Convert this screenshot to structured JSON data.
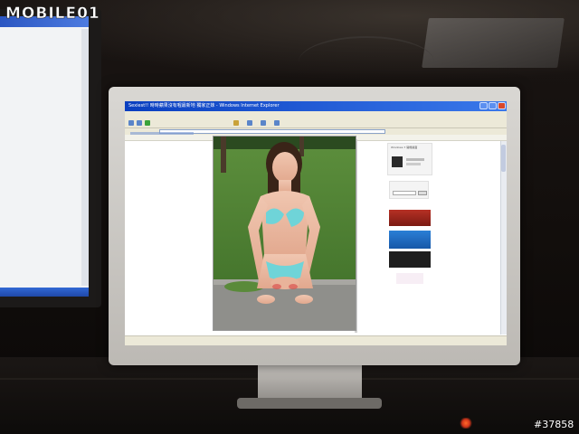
{
  "watermark": {
    "brand": "MOBILE01"
  },
  "photo_id": "#37858",
  "browser": {
    "window_title": "Sexiest!! 時時蘋果沒有喔最新地 獨家正妹 - Windows Internet Explorer",
    "sidebar_caption": "Windows 7 開機畫面"
  },
  "colors": {
    "xp_titlebar": "#0a3fc0",
    "page_bg": "#ffffff",
    "grass": "#3b6b2a",
    "swimsuit": "#6fd4d8",
    "desk_led": "#ff6a2a"
  }
}
